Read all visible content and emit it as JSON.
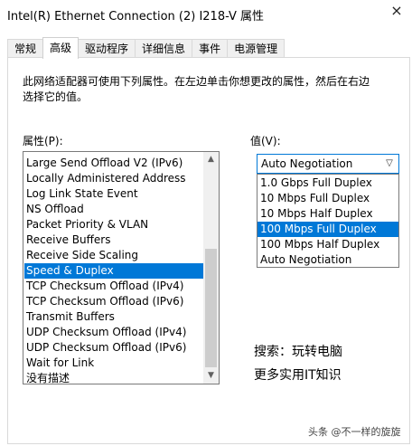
{
  "window": {
    "title": "Intel(R) Ethernet Connection (2) I218-V 属性",
    "close_label": "×"
  },
  "tabs": [
    {
      "label": "常规"
    },
    {
      "label": "高级",
      "active": true
    },
    {
      "label": "驱动程序"
    },
    {
      "label": "详细信息"
    },
    {
      "label": "事件"
    },
    {
      "label": "电源管理"
    }
  ],
  "advanced": {
    "description": "此网络适配器可使用下列属性。在左边单击你想更改的属性，然后在右边选择它的值。",
    "property_label": "属性(P):",
    "value_label": "值(V):",
    "properties": [
      {
        "label": "Large Send Offload V2 (IPv6)"
      },
      {
        "label": "Locally Administered Address"
      },
      {
        "label": "Log Link State Event"
      },
      {
        "label": "NS Offload"
      },
      {
        "label": "Packet Priority & VLAN"
      },
      {
        "label": "Receive Buffers"
      },
      {
        "label": "Receive Side Scaling"
      },
      {
        "label": "Speed & Duplex",
        "selected": true
      },
      {
        "label": "TCP Checksum Offload (IPv4)"
      },
      {
        "label": "TCP Checksum Offload (IPv6)"
      },
      {
        "label": "Transmit Buffers"
      },
      {
        "label": "UDP Checksum Offload (IPv4)"
      },
      {
        "label": "UDP Checksum Offload (IPv6)"
      },
      {
        "label": "Wait for Link"
      },
      {
        "label": "没有描述"
      }
    ],
    "value_current": "Auto Negotiation",
    "value_options": [
      {
        "label": "1.0 Gbps Full Duplex"
      },
      {
        "label": "10 Mbps Full Duplex"
      },
      {
        "label": "10 Mbps Half Duplex"
      },
      {
        "label": "100 Mbps Full Duplex",
        "highlighted": true
      },
      {
        "label": "100 Mbps Half Duplex"
      },
      {
        "label": "Auto Negotiation"
      }
    ]
  },
  "overlay": {
    "line1": "搜索：玩转电脑",
    "line2": "更多实用IT知识",
    "watermark": "头条 @不一样的旋旋"
  },
  "colors": {
    "selection": "#0078d7",
    "scrollbar_thumb": "#cdcdcd"
  }
}
